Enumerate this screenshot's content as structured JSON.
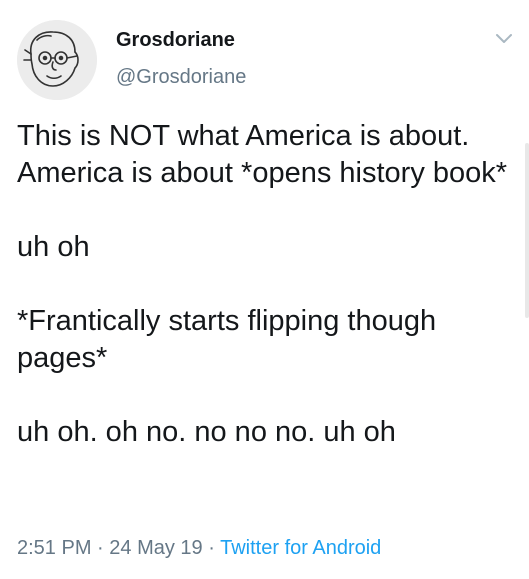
{
  "author": {
    "display_name": "Grosdoriane",
    "handle": "@Grosdoriane",
    "avatar_icon": "cartoon-face-avatar"
  },
  "menu": {
    "icon": "chevron-down-icon"
  },
  "tweet": {
    "paragraphs": [
      "This is NOT what America is about. America is about *opens history book*",
      "uh oh",
      "*Frantically starts flipping though pages*",
      "uh oh. oh no. no no no. uh oh"
    ]
  },
  "meta": {
    "time": "2:51 PM",
    "separator": "·",
    "date": "24 May 19",
    "source": "Twitter for Android"
  },
  "colors": {
    "text": "#14171a",
    "secondary": "#657786",
    "link": "#1da1f2"
  }
}
